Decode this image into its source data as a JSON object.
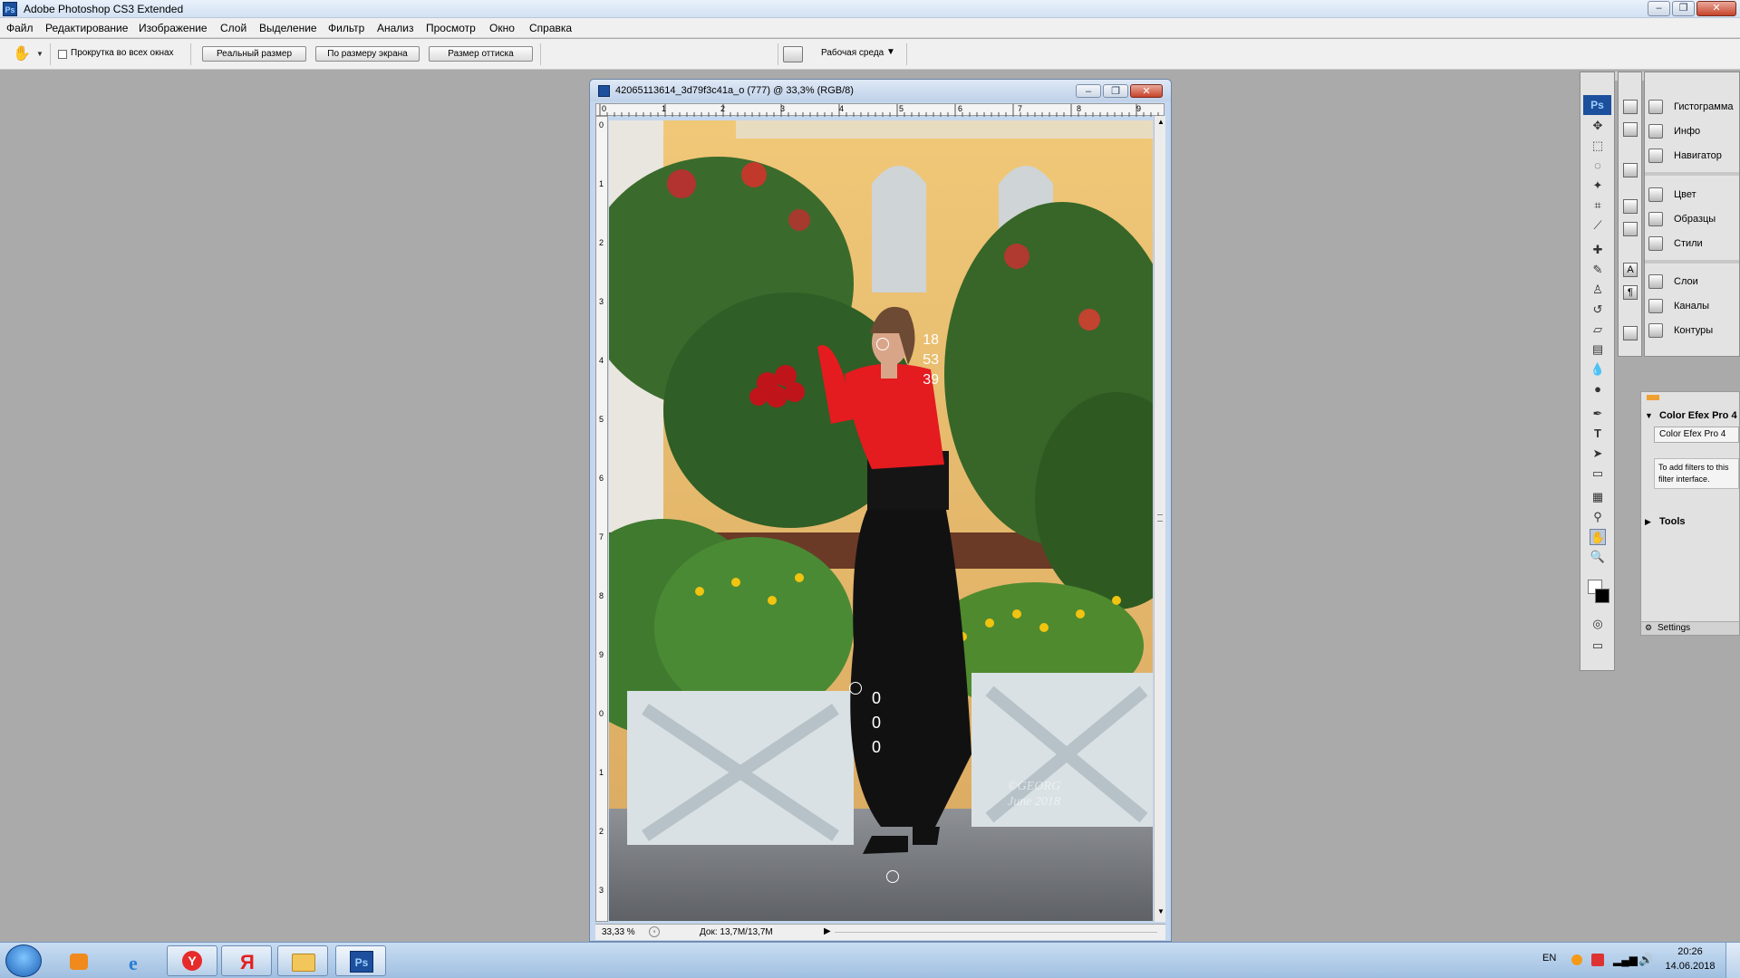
{
  "app": {
    "title": "Adobe Photoshop CS3 Extended",
    "logo": "Ps",
    "window_controls": [
      "–",
      "❐",
      "✕"
    ]
  },
  "menu": [
    "Файл",
    "Редактирование",
    "Изображение",
    "Слой",
    "Выделение",
    "Фильтр",
    "Анализ",
    "Просмотр",
    "Окно",
    "Справка"
  ],
  "options": {
    "checkbox_label": "Прокрутка во всех окнах",
    "btn_actual": "Реальный размер",
    "btn_fit": "По размеру экрана",
    "btn_print": "Размер оттиска",
    "workspace": "Рабочая среда"
  },
  "document": {
    "title": "42065113614_3d79f3c41a_o (777) @ 33,3% (RGB/8)",
    "h_ruler": [
      "0",
      "1",
      "2",
      "3",
      "4",
      "5",
      "6",
      "7",
      "8",
      "9"
    ],
    "v_ruler": [
      "0",
      "1",
      "2",
      "3",
      "4",
      "5",
      "6",
      "7",
      "8",
      "9",
      "0",
      "1",
      "2",
      "3"
    ],
    "sampler1": {
      "id": "1",
      "values": [
        "18",
        "53",
        "39"
      ]
    },
    "sampler2": {
      "id": "2",
      "values": [
        "0",
        "0",
        "0"
      ]
    },
    "watermark_line1": "©GEORG",
    "watermark_line2": "June 2018",
    "zoom": "33,33 %",
    "doc_size": "Док: 13,7M/13,7M"
  },
  "panels": {
    "group1": [
      "Гистограмма",
      "Инфо",
      "Навигатор"
    ],
    "group2": [
      "Цвет",
      "Образцы",
      "Стили"
    ],
    "group3": [
      "Слои",
      "Каналы",
      "Контуры"
    ]
  },
  "color_efex": {
    "header": "Color Efex Pro 4",
    "dropdown": "Color Efex Pro 4",
    "hint": "To add filters to this filter interface.",
    "tools_label": "Tools",
    "settings": "Settings"
  },
  "taskbar": {
    "lang": "EN",
    "time": "20:26",
    "date": "14.06.2018"
  },
  "colors": {
    "dress_red": "#e41b1f",
    "ps_blue": "#1c4f9c"
  }
}
